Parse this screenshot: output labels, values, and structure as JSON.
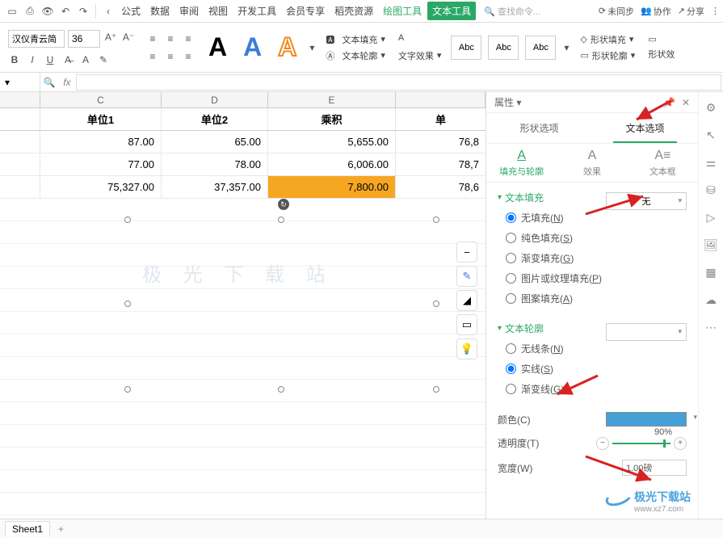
{
  "topbar": {
    "menus": [
      "公式",
      "数据",
      "审阅",
      "视图",
      "开发工具",
      "会员专享",
      "稻壳资源"
    ],
    "green_menu": "绘图工具",
    "tag": "文本工具",
    "search_placeholder": "查找命令...",
    "unsync": "未同步",
    "coop": "协作",
    "share": "分享"
  },
  "ribbon": {
    "font_name": "汉仪青云简",
    "font_size": "36",
    "text_fill": "文本填充",
    "text_outline": "文本轮廓",
    "text_effect": "文字效果",
    "abc": "Abc",
    "shape_fill": "形状填充",
    "shape_outline": "形状轮廓",
    "shape_effect": "形状效"
  },
  "grid": {
    "cols": [
      "C",
      "D",
      "E"
    ],
    "partial_col": "",
    "headers": {
      "c": "单位1",
      "d": "单位2",
      "e": "乘积",
      "f": "单"
    },
    "rows": [
      {
        "c": "87.00",
        "d": "65.00",
        "e": "5,655.00",
        "f": "76,8"
      },
      {
        "c": "77.00",
        "d": "78.00",
        "e": "6,006.00",
        "f": "78,7"
      },
      {
        "c": "75,327.00",
        "d": "37,357.00",
        "e": "7,800.00",
        "f": "78,6"
      }
    ],
    "watermark": "极 光 下 载 站"
  },
  "sheets": {
    "name": "Sheet1"
  },
  "panel": {
    "attr": "属性",
    "tabs": {
      "shape": "形状选项",
      "text": "文本选项"
    },
    "subtabs": {
      "fill": "填充与轮廓",
      "effect": "效果",
      "textbox": "文本框"
    },
    "sec_fill": "文本填充",
    "fill_none_dd": "无",
    "fill_opts": {
      "none": "无填充(N)",
      "solid": "纯色填充(S)",
      "grad": "渐变填充(G)",
      "pic": "图片或纹理填充(P)",
      "pattern": "图案填充(A)"
    },
    "sec_outline": "文本轮廓",
    "outline_opts": {
      "none": "无线条(N)",
      "solid": "实线(S)",
      "grad": "渐变线(G)"
    },
    "color_lbl": "颜色(C)",
    "opacity_lbl": "透明度(T)",
    "opacity_val": "90%",
    "width_lbl": "宽度(W)",
    "width_val": "1.00磅"
  },
  "branding": {
    "name": "极光下载站",
    "url": "www.xz7.com"
  }
}
